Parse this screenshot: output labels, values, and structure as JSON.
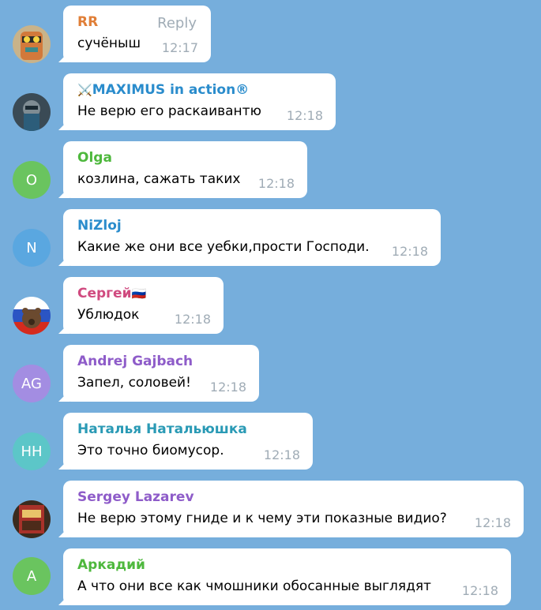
{
  "messages": [
    {
      "name": "RR",
      "name_color": "#e07f38",
      "text": "сучёныш",
      "time": "12:17",
      "reply": "Reply",
      "avatar": {
        "type": "image",
        "icon": "cartoon-character-avatar"
      }
    },
    {
      "name": "MAXIMUS in action®",
      "name_emoji": "⚔️",
      "name_color": "#2a8ccc",
      "text": "Не верю его раскаивантю",
      "time": "12:18",
      "avatar": {
        "type": "image",
        "icon": "masked-person-avatar"
      }
    },
    {
      "name": "Olga",
      "name_color": "#4eb83d",
      "text": "козлина, сажать таких",
      "time": "12:18",
      "avatar": {
        "type": "initials",
        "initials": "O",
        "color": "#6ac45f"
      }
    },
    {
      "name": "NiZloj",
      "name_color": "#2a8ccc",
      "text": "Какие же они все уебки,прости Господи.",
      "time": "12:18",
      "avatar": {
        "type": "initials",
        "initials": "N",
        "color": "#5aa7e0"
      }
    },
    {
      "name": "Сергей",
      "name_emoji": "🇷🇺",
      "name_color": "#d04a7f",
      "text": "Ублюдок",
      "time": "12:18",
      "avatar": {
        "type": "image",
        "icon": "bear-flag-avatar"
      }
    },
    {
      "name": "Andrej Gajbach",
      "name_color": "#8e5cc9",
      "text": "Запел, соловей!",
      "time": "12:18",
      "avatar": {
        "type": "initials",
        "initials": "AG",
        "color": "#a38de2"
      }
    },
    {
      "name": "Наталья Натальюшка",
      "name_color": "#2a9ab5",
      "text": "Это точно биомусор.",
      "time": "12:18",
      "avatar": {
        "type": "initials",
        "initials": "HH",
        "color": "#5cc6c8"
      }
    },
    {
      "name": "Sergey Lazarev",
      "name_color": "#8e5cc9",
      "text": "Не верю этому гниде и к чему эти показные видио?",
      "time": "12:18",
      "avatar": {
        "type": "image",
        "icon": "poster-avatar"
      }
    },
    {
      "name": "Аркадий",
      "name_color": "#4eb83d",
      "text": "А что они все как чмошники обосанные выглядят",
      "time": "12:18",
      "avatar": {
        "type": "initials",
        "initials": "A",
        "color": "#6ac45f"
      }
    }
  ]
}
